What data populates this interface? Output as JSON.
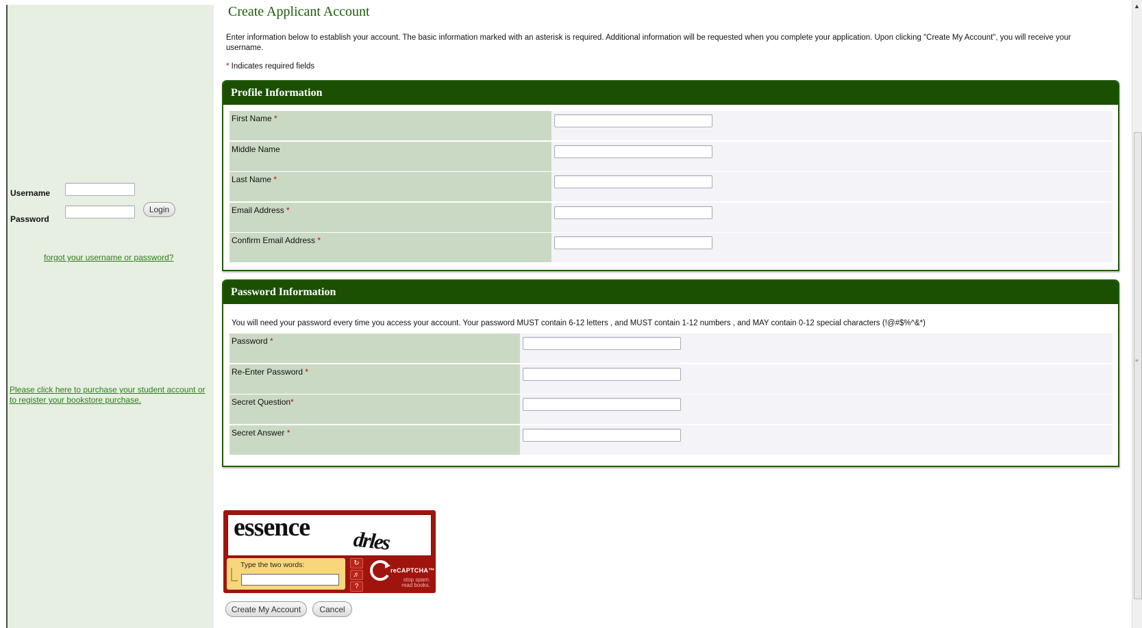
{
  "login": {
    "username_label": "Username",
    "password_label": "Password",
    "login_button": "Login",
    "forgot_link": "forgot your username or password?",
    "purchase_link_line1": "Please click here to purchase your student account or",
    "purchase_link_line2": "to register your bookstore purchase."
  },
  "page": {
    "title": "Create Applicant Account",
    "intro": "Enter information below to establish your account. The basic information marked with an asterisk is required. Additional information will be requested when you complete your application. Upon clicking \"Create My Account\", you will receive your username.",
    "required_star": "*",
    "required_note": " Indicates required fields"
  },
  "profile": {
    "header": "Profile Information",
    "fields": [
      {
        "label": "First Name",
        "star": "*",
        "value": ""
      },
      {
        "label": "Middle Name",
        "star": "",
        "value": ""
      },
      {
        "label": "Last Name",
        "star": "*",
        "value": ""
      },
      {
        "label": "Email Address",
        "star": "*",
        "value": ""
      },
      {
        "label": "Confirm Email Address",
        "star": "*",
        "value": ""
      }
    ]
  },
  "password_section": {
    "header": "Password Information",
    "note": "You will need your password every time you access your account. Your password MUST contain 6-12 letters , and MUST contain 1-12 numbers , and MAY contain 0-12 special characters (!@#$%^&*)",
    "fields": [
      {
        "label": "Password",
        "star": "*",
        "value": ""
      },
      {
        "label": "Re-Enter Password",
        "star": "*",
        "value": ""
      },
      {
        "label": "Secret Question",
        "star": "*",
        "value": ""
      },
      {
        "label": "Secret Answer",
        "star": "*",
        "value": ""
      }
    ]
  },
  "captcha": {
    "word1": "essence",
    "word2": "drles",
    "prompt": "Type the two words:",
    "brand": "reCAPTCHA™",
    "slogan_line1": "stop spam.",
    "slogan_line2": "read books.",
    "icons": [
      "refresh-icon",
      "audio-icon",
      "help-icon"
    ]
  },
  "actions": {
    "create_button": "Create My Account",
    "cancel_button": "Cancel"
  },
  "colors": {
    "brand_green": "#1b4f02",
    "sidebar_bg": "#e6efe1",
    "label_bg": "#cad9c3",
    "link": "#2f7a1e",
    "required": "#cc0000",
    "captcha_red": "#a0140e"
  }
}
